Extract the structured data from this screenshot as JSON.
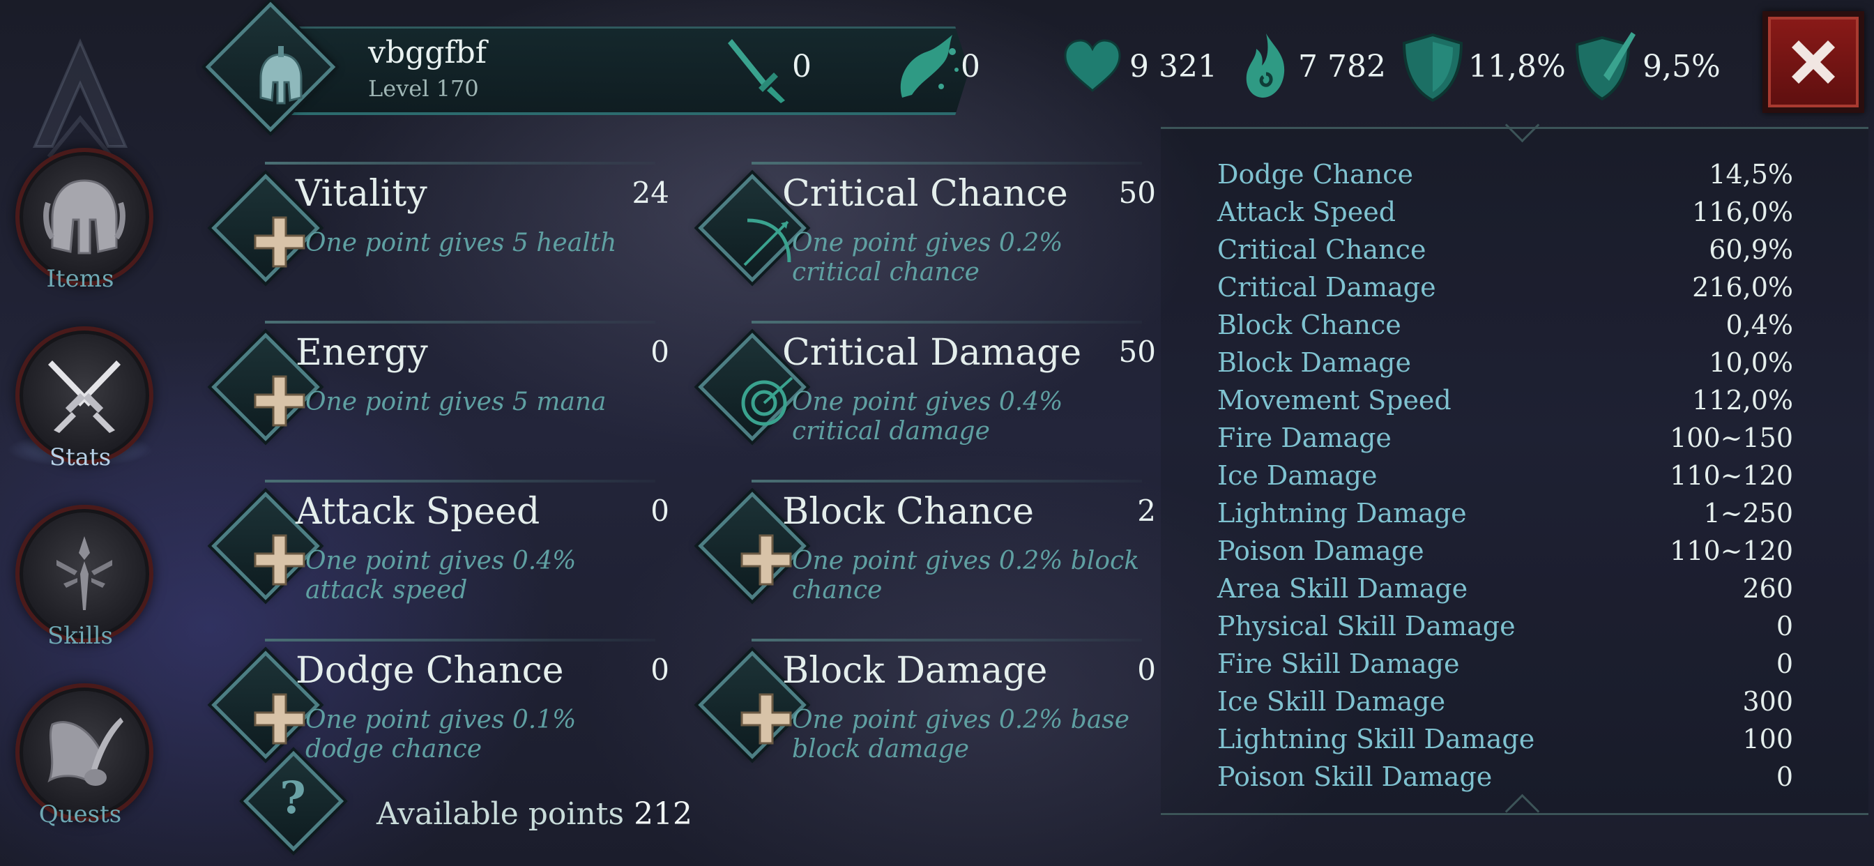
{
  "sidebar": {
    "items": [
      {
        "label": "Items",
        "icon": "helmet-icon"
      },
      {
        "label": "Stats",
        "icon": "crossed-swords-icon"
      },
      {
        "label": "Skills",
        "icon": "skills-emblem-icon"
      },
      {
        "label": "Quests",
        "icon": "scroll-quill-icon"
      }
    ],
    "active": "Stats"
  },
  "player": {
    "name": "vbggfbf",
    "level": "Level 170"
  },
  "header": {
    "sword_count": "0",
    "dust_count": "0",
    "health": "9 321",
    "mana": "7 782",
    "armor": "11,8%",
    "resist": "9,5%"
  },
  "attributes": [
    {
      "name": "Vitality",
      "value": "24",
      "desc": "One point gives 5 health"
    },
    {
      "name": "Critical Chance",
      "value": "50",
      "desc": "One point gives 0.2% critical chance"
    },
    {
      "name": "Energy",
      "value": "0",
      "desc": "One point gives 5 mana"
    },
    {
      "name": "Critical Damage",
      "value": "50",
      "desc": "One point gives 0.4% critical damage"
    },
    {
      "name": "Attack Speed",
      "value": "0",
      "desc": "One point gives 0.4% attack speed"
    },
    {
      "name": "Block Chance",
      "value": "2",
      "desc": "One point gives 0.2% block chance"
    },
    {
      "name": "Dodge Chance",
      "value": "0",
      "desc": "One point gives 0.1% dodge chance"
    },
    {
      "name": "Block Damage",
      "value": "0",
      "desc": "One point gives 0.2% base block damage"
    }
  ],
  "available": {
    "label": "Available points",
    "value": "212"
  },
  "stats": [
    {
      "name": "Dodge Chance",
      "value": "14,5%"
    },
    {
      "name": "Attack Speed",
      "value": "116,0%"
    },
    {
      "name": "Critical Chance",
      "value": "60,9%"
    },
    {
      "name": "Critical Damage",
      "value": "216,0%"
    },
    {
      "name": "Block Chance",
      "value": "0,4%"
    },
    {
      "name": "Block Damage",
      "value": "10,0%"
    },
    {
      "name": "Movement Speed",
      "value": "112,0%"
    },
    {
      "name": "Fire Damage",
      "value": "100~150"
    },
    {
      "name": "Ice Damage",
      "value": "110~120"
    },
    {
      "name": "Lightning Damage",
      "value": "1~250"
    },
    {
      "name": "Poison Damage",
      "value": "110~120"
    },
    {
      "name": "Area Skill Damage",
      "value": "260"
    },
    {
      "name": "Physical Skill Damage",
      "value": "0"
    },
    {
      "name": "Fire Skill Damage",
      "value": "0"
    },
    {
      "name": "Ice Skill Damage",
      "value": "300"
    },
    {
      "name": "Lightning Skill Damage",
      "value": "100"
    },
    {
      "name": "Poison Skill Damage",
      "value": "0"
    }
  ],
  "colors": {
    "accent_teal": "#2c6b6e",
    "stat_name": "#7fc2d0",
    "desc_text": "#5fa0a2",
    "close_red": "#8a1a18"
  }
}
